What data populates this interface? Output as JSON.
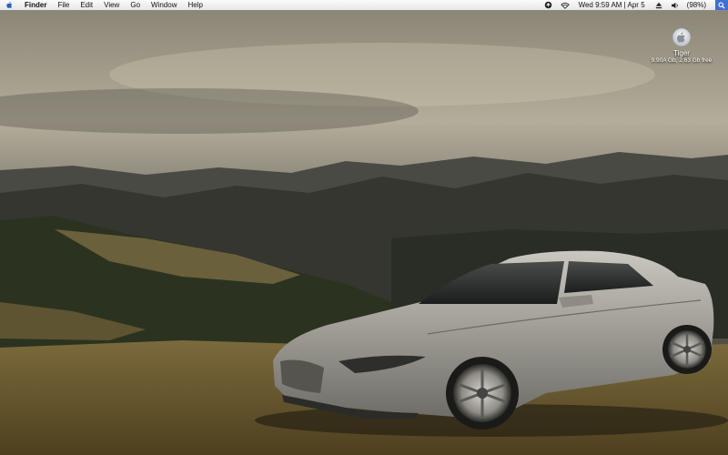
{
  "menubar": {
    "app_name": "Finder",
    "items": [
      "File",
      "Edit",
      "View",
      "Go",
      "Window",
      "Help"
    ],
    "clock": "Wed 9:59 AM | Apr 5",
    "battery": "(98%)",
    "status_icons": [
      "sync-icon",
      "wifi-icon",
      "eject-icon",
      "volume-icon",
      "spotlight-icon"
    ]
  },
  "desktop": {
    "drive_name": "Tiger",
    "drive_info": "9.90A Gb, 2.63 Gb free"
  },
  "colors": {
    "spotlight": "#3d6fd4",
    "sky": "#6e6a5c",
    "grass": "#6b5a2e",
    "car": "#9a9890"
  }
}
